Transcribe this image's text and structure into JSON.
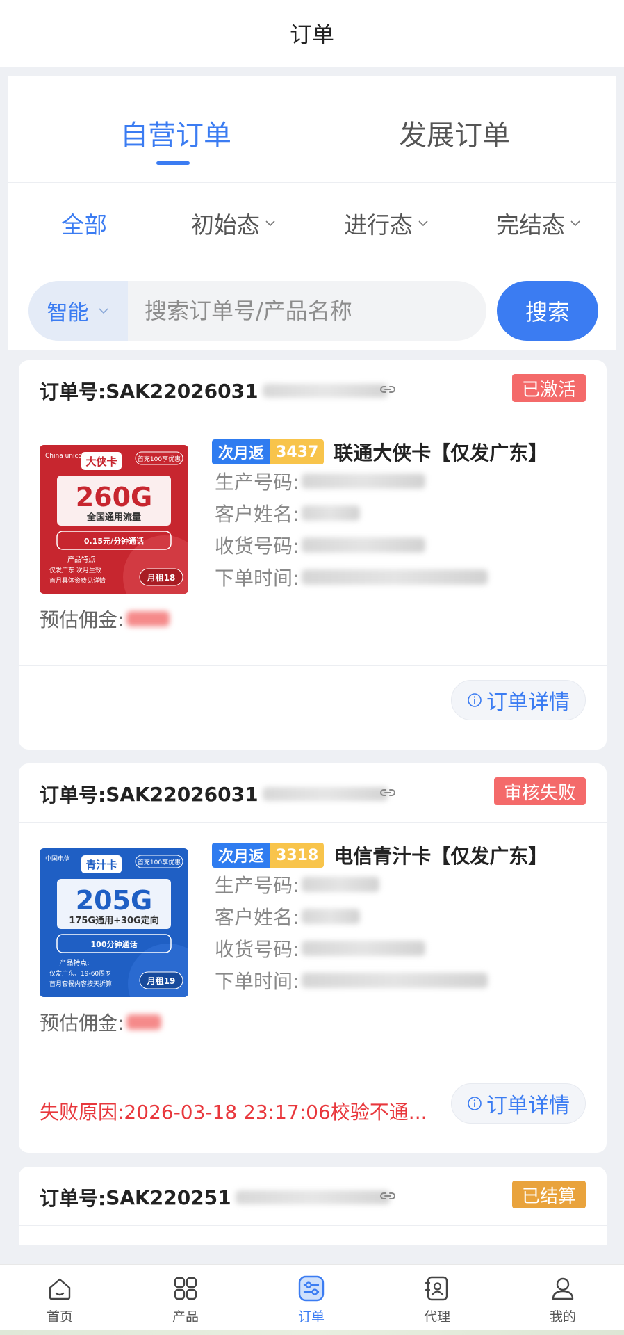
{
  "topbar": {
    "title": "订单"
  },
  "tabs": [
    {
      "label": "自营订单",
      "active": true
    },
    {
      "label": "发展订单",
      "active": false
    }
  ],
  "filters": [
    {
      "label": "全部",
      "active": true
    },
    {
      "label": "初始态",
      "active": false
    },
    {
      "label": "进行态",
      "active": false
    },
    {
      "label": "完结态",
      "active": false
    }
  ],
  "search": {
    "select_value": "智能",
    "placeholder": "搜索订单号/产品名称",
    "button_label": "搜索"
  },
  "orders": [
    {
      "order_label": "订单号:",
      "order_no_visible": "SAK22026031",
      "status": "已激活",
      "status_color": "#f46a6a",
      "tag_ret": "次月返",
      "tag_num": "3437",
      "product_name": "联通大侠卡【仅发广东】",
      "fields": [
        {
          "label": "生产号码:"
        },
        {
          "label": "客户姓名:"
        },
        {
          "label": "收货号码:"
        },
        {
          "label": "下单时间:"
        }
      ],
      "commission_label": "预估佣金:",
      "detail_label": "订单详情",
      "card_image": {
        "brand": "大侠卡",
        "volume": "260G",
        "subtitle": "全国通用流量",
        "call": "0.15元/分钟通话",
        "badge": "首充100享优惠",
        "features_title": "产品特点",
        "feature_1": "仅发广东 次月生效",
        "feature_2": "首月具体资费见详情",
        "rent": "月租18",
        "bg_color": "#c7262f"
      }
    },
    {
      "order_label": "订单号:",
      "order_no_visible": "SAK22026031",
      "status": "审核失败",
      "status_color": "#f46a6a",
      "tag_ret": "次月返",
      "tag_num": "3318",
      "product_name": "电信青汁卡【仅发广东】",
      "fields": [
        {
          "label": "生产号码:"
        },
        {
          "label": "客户姓名:"
        },
        {
          "label": "收货号码:"
        },
        {
          "label": "下单时间:"
        }
      ],
      "commission_label": "预估佣金:",
      "detail_label": "订单详情",
      "fail_reason": "失败原因:2026-03-18 23:17:06校验不通...",
      "card_image": {
        "brand": "青汁卡",
        "volume": "205G",
        "subtitle": "175G通用+30G定向",
        "call": "100分钟通话",
        "badge": "首充100享优惠",
        "features_title": "产品特点:",
        "feature_1": "仅发广东、19-60周岁",
        "feature_2": "首月套餐内容按天折算",
        "rent": "月租19",
        "bg_color": "#1f5fc4"
      }
    },
    {
      "order_label": "订单号:",
      "order_no_visible": "SAK220251",
      "status": "已结算",
      "status_color": "#e9a33c"
    }
  ],
  "tabbar": [
    {
      "label": "首页",
      "icon": "home-icon",
      "active": false
    },
    {
      "label": "产品",
      "icon": "grid-icon",
      "active": false
    },
    {
      "label": "订单",
      "icon": "order-icon",
      "active": true
    },
    {
      "label": "代理",
      "icon": "agent-icon",
      "active": false
    },
    {
      "label": "我的",
      "icon": "user-icon",
      "active": false
    }
  ],
  "colors": {
    "accent": "#3b7cf2",
    "danger": "#e8373c",
    "badge_red": "#f46a6a",
    "badge_orange": "#e9a33c"
  }
}
